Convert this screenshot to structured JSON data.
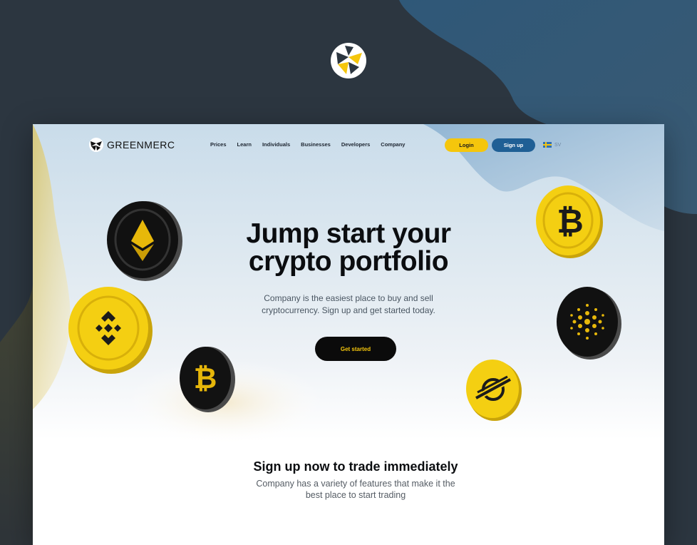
{
  "colors": {
    "backdrop": "#2c3640",
    "accent_yellow": "#f5c60c",
    "brand_blue": "#1f5f95",
    "text_dark": "#0b0d10"
  },
  "site": {
    "brand_name": "GREENMERC",
    "nav": [
      "Prices",
      "Learn",
      "Individuals",
      "Businesses",
      "Developers",
      "Company"
    ],
    "login_label": "Login",
    "signup_label": "Sign up",
    "language": "SV"
  },
  "hero": {
    "title": "Jump start your\ncrypto portfolio",
    "subtitle": "Company is the easiest place to buy and sell cryptocurrency. Sign up and get started today.",
    "cta_label": "Get started"
  },
  "features": {
    "title": "Sign up now to trade immediately",
    "subtitle": "Company has a variety of features that make it the best place to start trading"
  },
  "coins": [
    {
      "name": "ethereum-coin-icon",
      "style": "black"
    },
    {
      "name": "binance-coin-icon",
      "style": "yellow"
    },
    {
      "name": "bitcoin-black-coin-icon",
      "style": "black"
    },
    {
      "name": "bitcoin-yellow-coin-icon",
      "style": "yellow"
    },
    {
      "name": "cardano-coin-icon",
      "style": "black"
    },
    {
      "name": "stellar-coin-icon",
      "style": "yellow"
    }
  ]
}
